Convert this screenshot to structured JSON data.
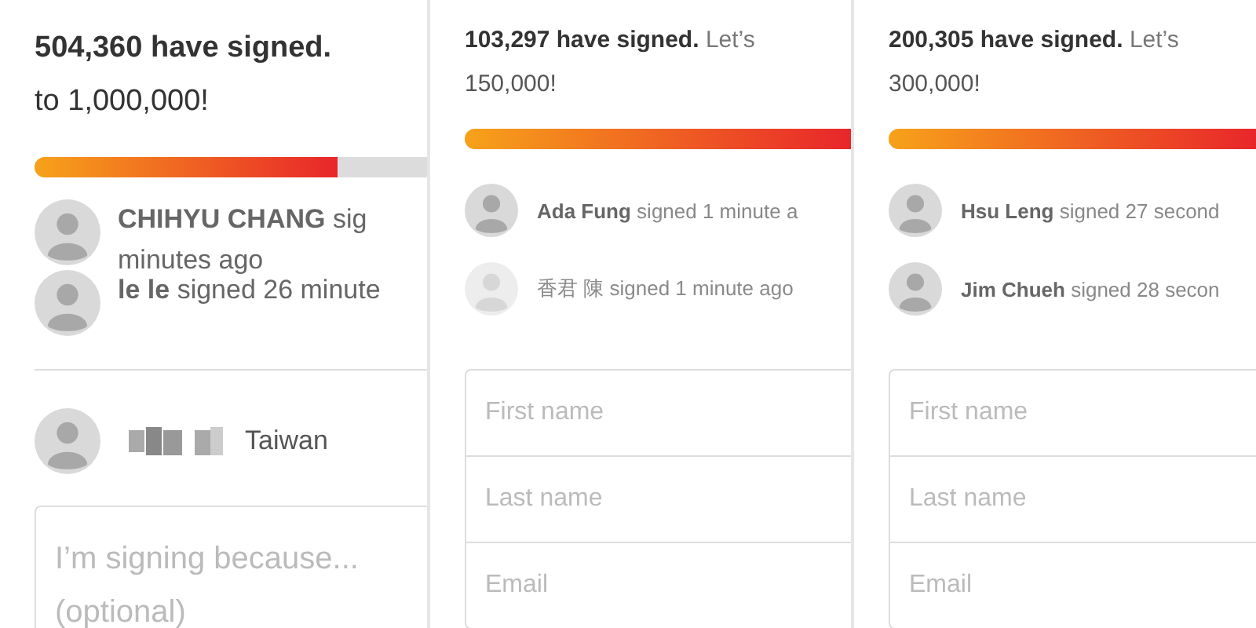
{
  "panels": [
    {
      "kind": "comment",
      "count": "504,360 have signed.",
      "goal": "to 1,000,000!",
      "progress": {
        "level": 0.77
      },
      "signers": [
        {
          "name": "CHIHYU CHANG",
          "text": " sig",
          "text_2": "minutes ago",
          "faded": false
        },
        {
          "name": "le le",
          "text": " signed 26 minute",
          "faded": false
        }
      ],
      "you": {
        "location": "Taiwan"
      },
      "comment_box": {
        "placeholder": "I’m signing because... (optional)"
      }
    },
    {
      "kind": "form",
      "count": "103,297 have signed.",
      "count_rest": "Let’s",
      "goal": "150,000!",
      "progress": {
        "level": 1
      },
      "signers": [
        {
          "name": "Ada Fung",
          "text": " signed 1 minute a",
          "faded": false
        },
        {
          "name": "香君 陳",
          "text": " signed 1 minute ago",
          "faded": true
        }
      ],
      "fields": [
        {
          "placeholder": "First name"
        },
        {
          "placeholder": "Last name"
        },
        {
          "placeholder": "Email"
        }
      ]
    },
    {
      "kind": "form",
      "count": "200,305 have signed.",
      "count_rest": "Let’s",
      "goal": "300,000!",
      "progress": {
        "level": 1
      },
      "signers": [
        {
          "name": "Hsu Leng",
          "text": " signed 27 second",
          "faded": false
        },
        {
          "name": "Jim Chueh",
          "text": " signed 28 secon",
          "faded": false
        }
      ],
      "fields": [
        {
          "placeholder": "First name"
        },
        {
          "placeholder": "Last name"
        },
        {
          "placeholder": "Email"
        }
      ]
    }
  ]
}
